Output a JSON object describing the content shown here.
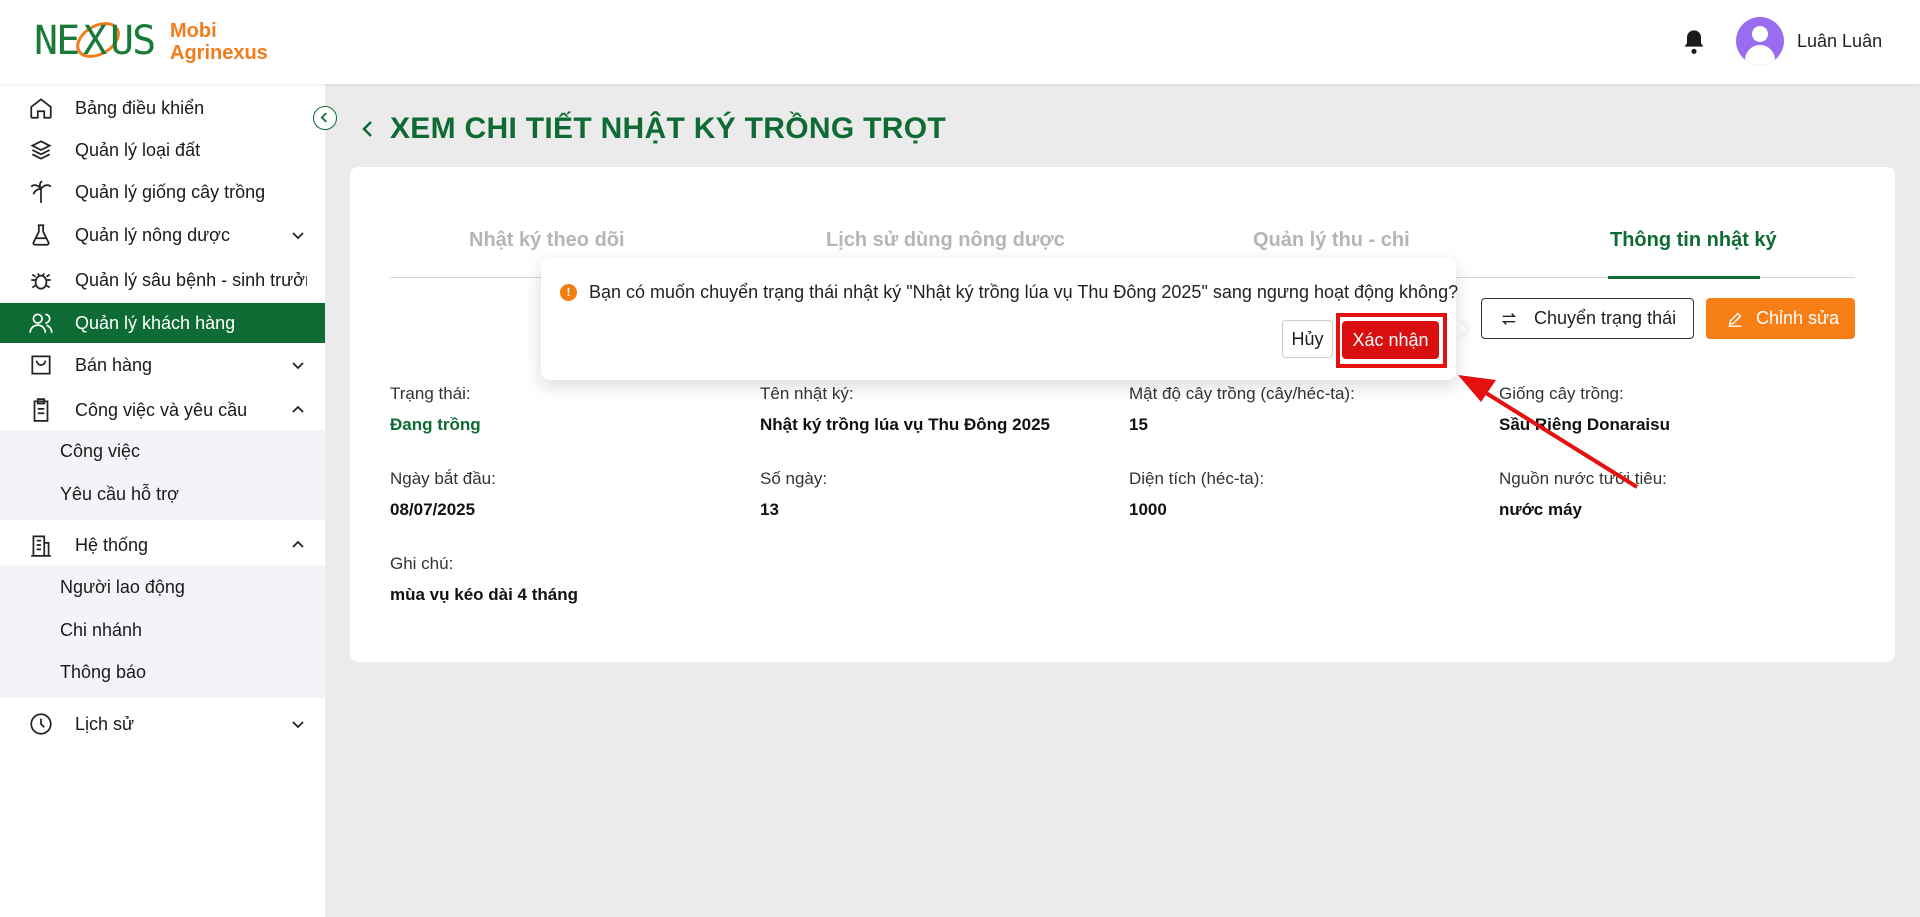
{
  "brand": {
    "line1": "Mobi",
    "line2": "Agrinexus",
    "logo_text": "NEXUS"
  },
  "header": {
    "username": "Luân Luân"
  },
  "sidebar": {
    "items": [
      {
        "label": "Bảng điều khiển"
      },
      {
        "label": "Quản lý loại đất"
      },
      {
        "label": "Quản lý giống cây trồng"
      },
      {
        "label": "Quản lý nông dược"
      },
      {
        "label": "Quản lý sâu bệnh - sinh trưởng"
      },
      {
        "label": "Quản lý khách hàng"
      },
      {
        "label": "Bán hàng"
      },
      {
        "label": "Công việc và yêu cầu"
      },
      {
        "label": "Hệ thống"
      },
      {
        "label": "Lịch sử"
      }
    ],
    "work_sub": [
      "Công việc",
      "Yêu cầu hỗ trợ"
    ],
    "system_sub": [
      "Người lao động",
      "Chi nhánh",
      "Thông báo"
    ]
  },
  "page": {
    "title": "XEM CHI TIẾT NHẬT KÝ TRỒNG TRỌT"
  },
  "tabs": [
    "Nhật ký theo dõi",
    "Lịch sử dùng nông dược",
    "Quản lý thu - chi",
    "Thông tin nhật ký"
  ],
  "actions": {
    "switch_status": "Chuyển trạng thái",
    "edit": "Chỉnh sửa"
  },
  "details": {
    "status": {
      "label": "Trạng thái:",
      "value": "Đang trồng"
    },
    "name": {
      "label": "Tên nhật ký:",
      "value": "Nhật ký trồng lúa vụ Thu Đông 2025"
    },
    "density": {
      "label": "Mật độ cây trồng (cây/héc-ta):",
      "value": "15"
    },
    "variety": {
      "label": "Giống cây trồng:",
      "value": "Sầu Riêng Donaraisu"
    },
    "start_date": {
      "label": "Ngày bắt đầu:",
      "value": "08/07/2025"
    },
    "days": {
      "label": "Số ngày:",
      "value": "13"
    },
    "area": {
      "label": "Diện tích (héc-ta):",
      "value": "1000"
    },
    "water": {
      "label": "Nguồn nước tưới tiêu:",
      "value": "nước máy"
    },
    "note": {
      "label": "Ghi chú:",
      "value": "mùa vụ kéo dài 4 tháng"
    }
  },
  "confirm": {
    "message": "Bạn có muốn chuyển trạng thái nhật ký \"Nhật ký trồng lúa vụ Thu Đông 2025\" sang ngưng hoạt động không?",
    "cancel": "Hủy",
    "ok": "Xác nhận"
  },
  "colors": {
    "primary": "#0e6b33",
    "accent": "#f77f15",
    "danger": "#d90f0f",
    "annotation": "#e51010"
  }
}
